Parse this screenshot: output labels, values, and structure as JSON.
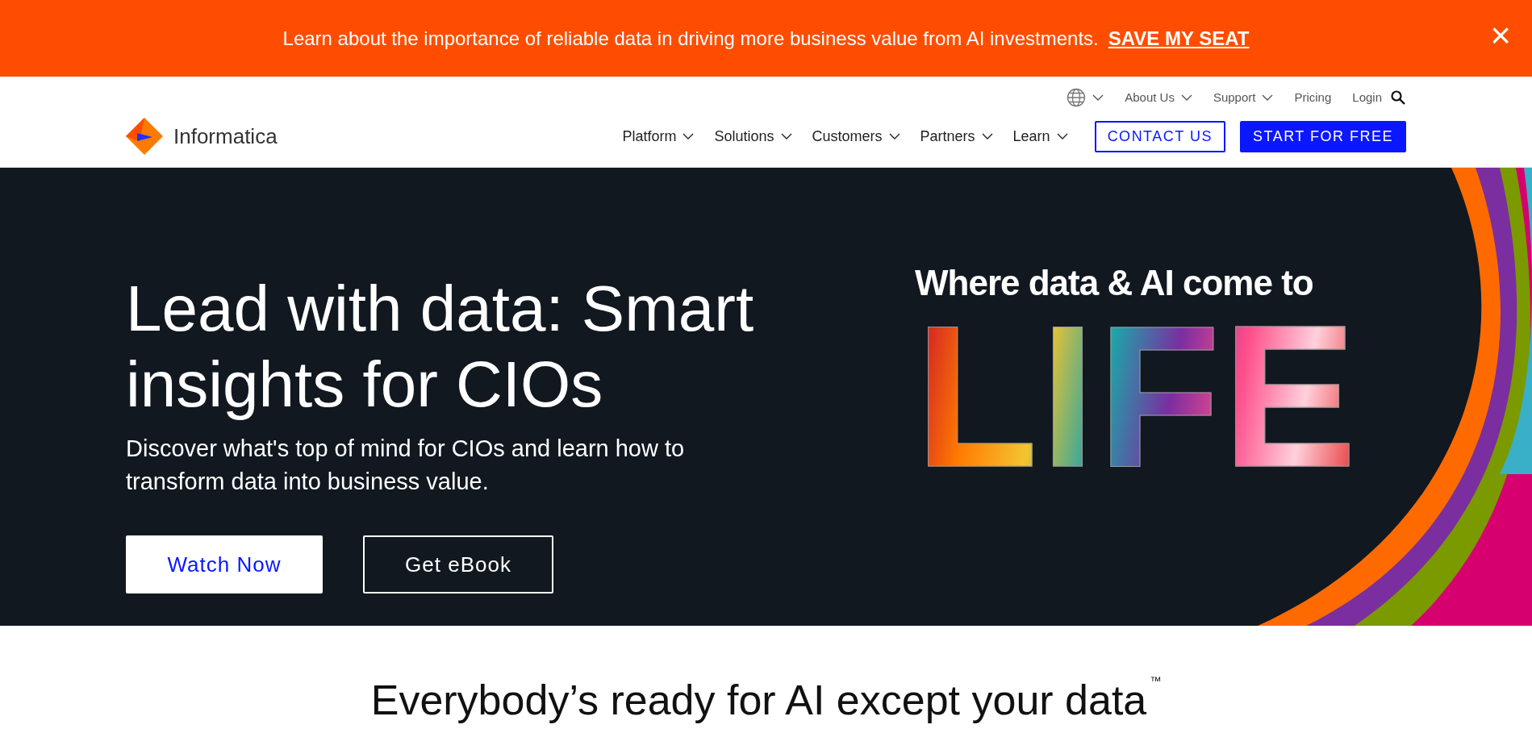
{
  "promo_banner": {
    "text": "Learn about the importance of reliable data in driving more business value from AI investments.",
    "link": "SAVE MY SEAT",
    "close": "×"
  },
  "utility_nav": [
    {
      "label": "About Us",
      "dropdown": true
    },
    {
      "label": "Support",
      "dropdown": true
    },
    {
      "label": "Pricing",
      "dropdown": false
    },
    {
      "label": "Login",
      "dropdown": false
    }
  ],
  "logo": {
    "text": "Informatica"
  },
  "main_nav": [
    {
      "label": "Platform"
    },
    {
      "label": "Solutions"
    },
    {
      "label": "Customers"
    },
    {
      "label": "Partners"
    },
    {
      "label": "Learn"
    }
  ],
  "header_buttons": [
    {
      "label": "CONTACT US",
      "kind": "outline"
    },
    {
      "label": "START FOR FREE",
      "kind": "solid"
    }
  ],
  "hero": {
    "title": "Lead with data: Smart insights for CIOs",
    "subtitle": "Discover what's top of mind for CIOs and learn how to transform data into business value.",
    "buttons": [
      {
        "label": "Watch Now",
        "kind": "solid"
      },
      {
        "label": "Get eBook",
        "kind": "outline"
      }
    ],
    "graphic": {
      "tagline": "Where data & AI come to",
      "word": "LIFE"
    }
  },
  "section": {
    "heading": "Everybody’s ready for AI except your data",
    "mark": "™"
  }
}
